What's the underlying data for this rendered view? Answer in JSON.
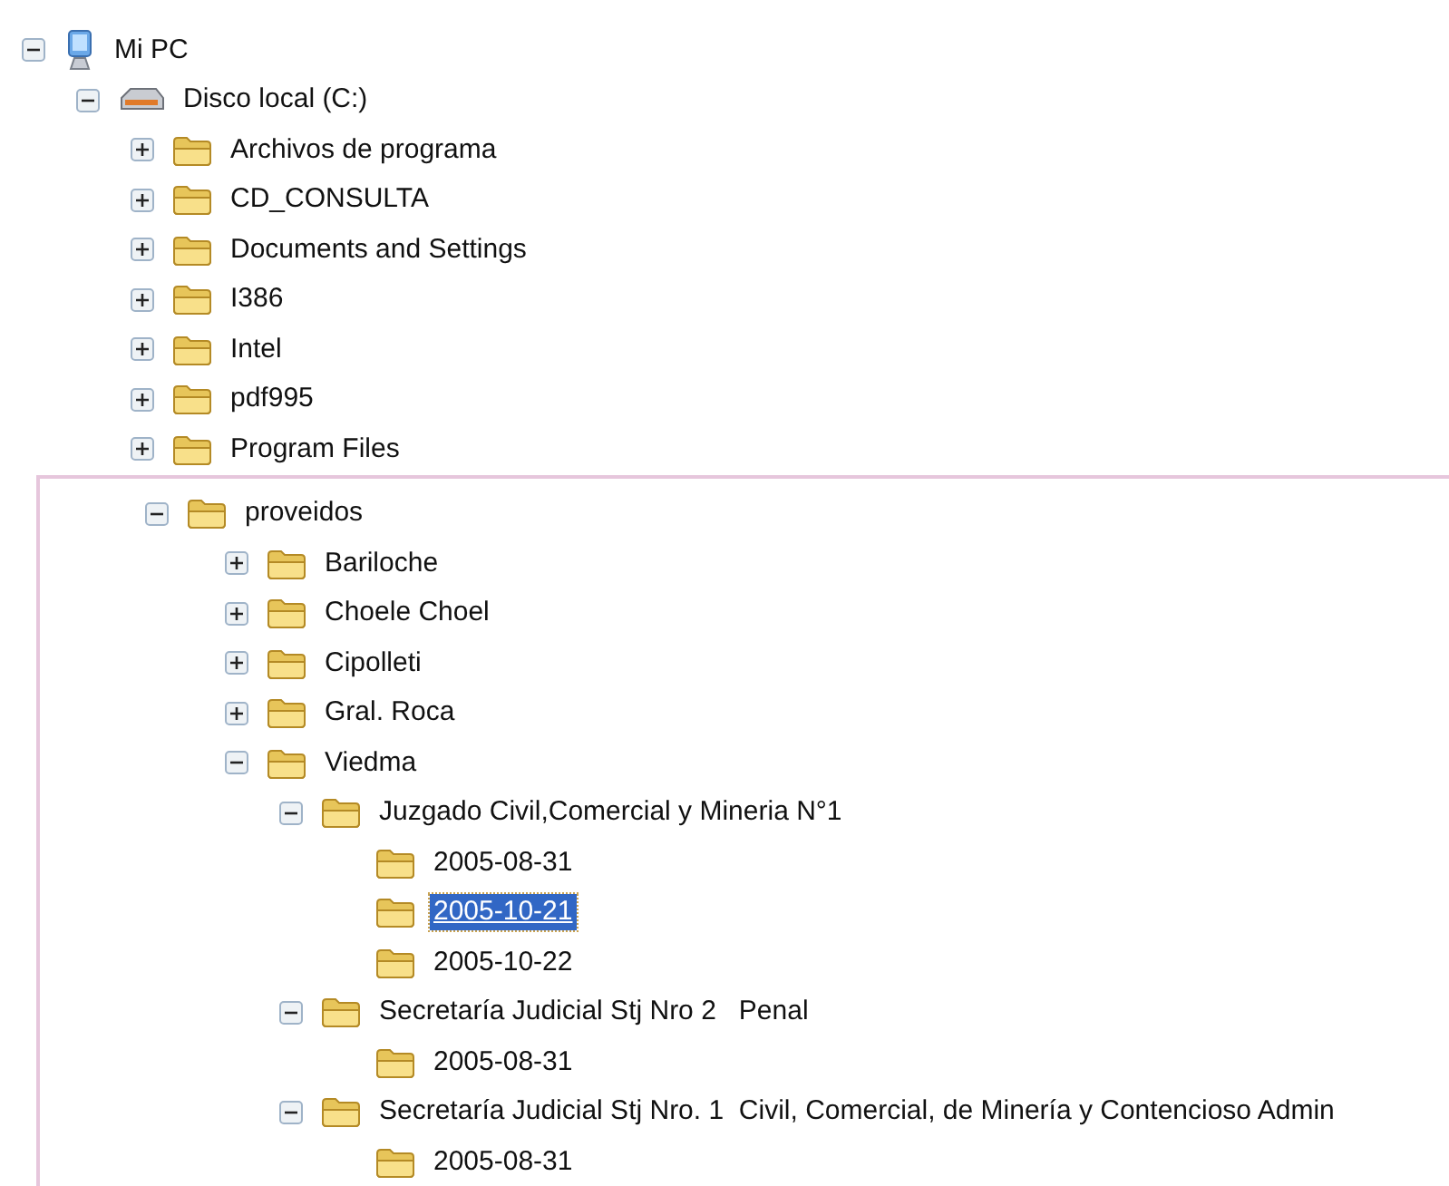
{
  "tree": [
    {
      "label": "Mi PC",
      "kind": "computer",
      "expanded": true,
      "selected": false,
      "children": [
        {
          "label": "Disco local (C:)",
          "kind": "drive",
          "expanded": true,
          "selected": false,
          "children": [
            {
              "label": "Archivos de programa",
              "kind": "folder",
              "expanded": false,
              "selected": false
            },
            {
              "label": "CD_CONSULTA",
              "kind": "folder",
              "expanded": false,
              "selected": false
            },
            {
              "label": "Documents and Settings",
              "kind": "folder",
              "expanded": false,
              "selected": false
            },
            {
              "label": "I386",
              "kind": "folder",
              "expanded": false,
              "selected": false
            },
            {
              "label": "Intel",
              "kind": "folder",
              "expanded": false,
              "selected": false
            },
            {
              "label": "pdf995",
              "kind": "folder",
              "expanded": false,
              "selected": false
            },
            {
              "label": "Program Files",
              "kind": "folder",
              "expanded": false,
              "selected": false
            },
            {
              "label": "proveidos",
              "kind": "folder",
              "expanded": true,
              "selected": false,
              "highlighted": true,
              "children": [
                {
                  "label": "Bariloche",
                  "kind": "folder",
                  "expanded": false,
                  "selected": false
                },
                {
                  "label": "Choele Choel",
                  "kind": "folder",
                  "expanded": false,
                  "selected": false
                },
                {
                  "label": "Cipolleti",
                  "kind": "folder",
                  "expanded": false,
                  "selected": false
                },
                {
                  "label": "Gral. Roca",
                  "kind": "folder",
                  "expanded": false,
                  "selected": false
                },
                {
                  "label": "Viedma",
                  "kind": "folder",
                  "expanded": true,
                  "selected": false,
                  "children": [
                    {
                      "label": "Juzgado Civil,Comercial y Mineria N°1",
                      "kind": "folder",
                      "expanded": true,
                      "selected": false,
                      "children": [
                        {
                          "label": "2005-08-31",
                          "kind": "folder",
                          "selected": false
                        },
                        {
                          "label": "2005-10-21",
                          "kind": "folder",
                          "selected": true
                        },
                        {
                          "label": "2005-10-22",
                          "kind": "folder",
                          "selected": false
                        }
                      ]
                    },
                    {
                      "label": "Secretaría Judicial Stj Nro 2   Penal",
                      "kind": "folder",
                      "expanded": true,
                      "selected": false,
                      "children": [
                        {
                          "label": "2005-08-31",
                          "kind": "folder",
                          "selected": false
                        }
                      ]
                    },
                    {
                      "label": "Secretaría Judicial Stj Nro. 1  Civil, Comercial, de Minería y Contencioso Admin",
                      "kind": "folder",
                      "expanded": true,
                      "selected": false,
                      "children": [
                        {
                          "label": "2005-08-31",
                          "kind": "folder",
                          "selected": false
                        }
                      ]
                    }
                  ]
                }
              ]
            }
          ]
        }
      ]
    }
  ]
}
